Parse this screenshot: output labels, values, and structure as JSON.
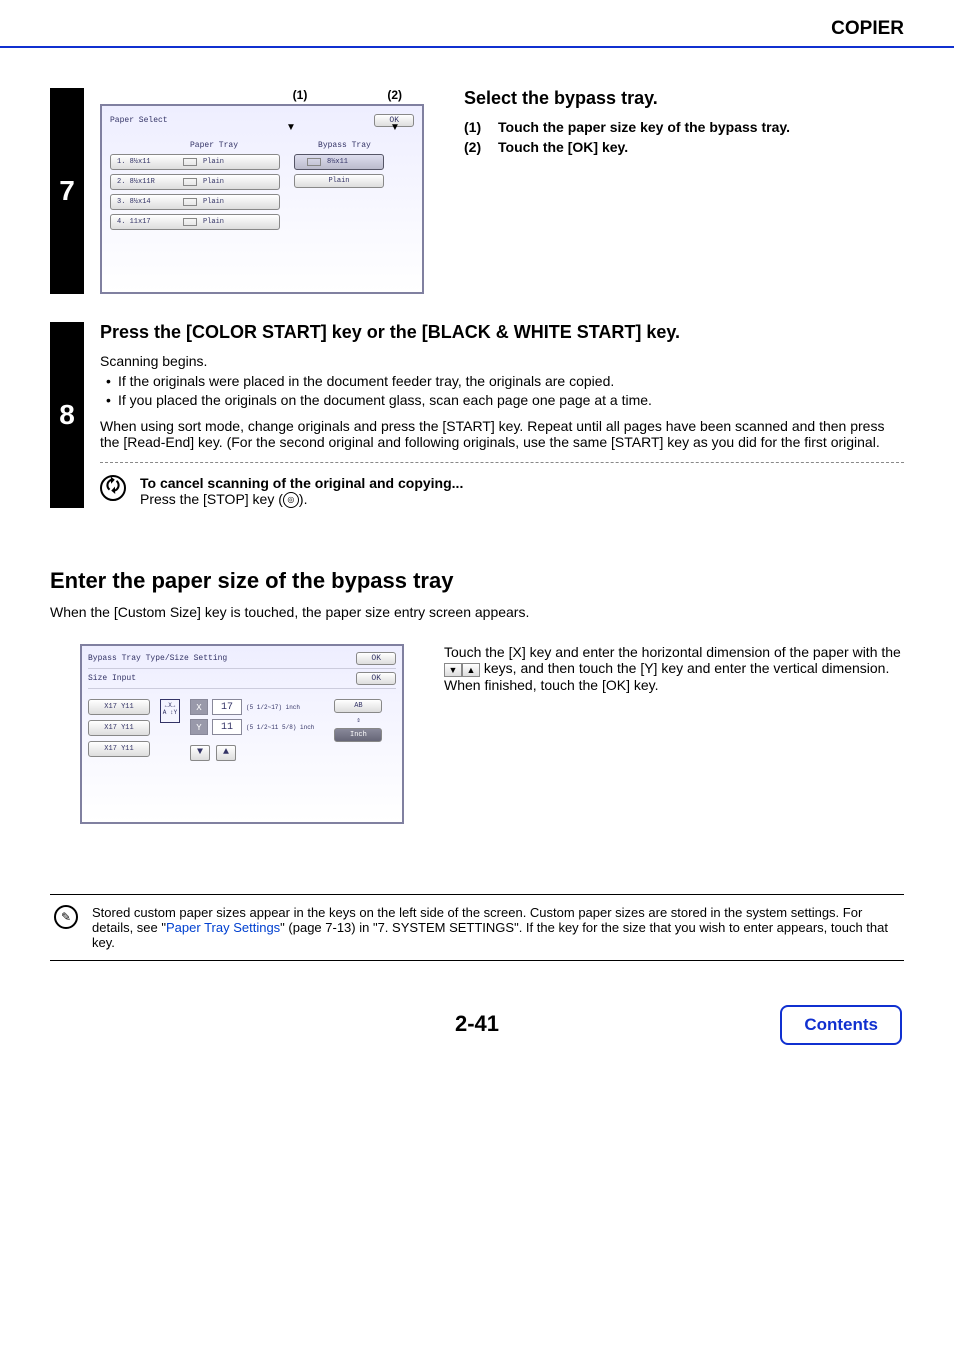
{
  "header": {
    "section": "COPIER"
  },
  "step7": {
    "number": "7",
    "callouts": [
      "(1)",
      "(2)"
    ],
    "screen": {
      "title": "Paper Select",
      "ok": "OK",
      "paper_tray_label": "Paper Tray",
      "bypass_tray_label": "Bypass Tray",
      "trays": [
        {
          "label": "1. 8½x11",
          "type": "Plain"
        },
        {
          "label": "2. 8½x11R",
          "type": "Plain"
        },
        {
          "label": "3. 8½x14",
          "type": "Plain"
        },
        {
          "label": "4. 11x17",
          "type": "Plain"
        }
      ],
      "bypass": {
        "size": "8½x11",
        "type": "Plain"
      }
    },
    "heading": "Select the bypass tray.",
    "items": [
      {
        "no": "(1)",
        "text": "Touch the paper size key of the bypass tray."
      },
      {
        "no": "(2)",
        "text": "Touch the [OK] key."
      }
    ]
  },
  "step8": {
    "number": "8",
    "heading": "Press the [COLOR START] key or the [BLACK & WHITE START] key.",
    "line1": "Scanning begins.",
    "bullets": [
      "If the originals were placed in the document feeder tray, the originals are copied.",
      "If you placed the originals on the document glass, scan each page one page at a time."
    ],
    "indent": "When using sort mode, change originals and press the [START] key. Repeat until all pages have been scanned and then press the [Read-End] key. (For the second original and following originals, use the same [START] key as you did for the first original.",
    "cancel_title": "To cancel scanning of the original and copying...",
    "cancel_text_a": "Press the [STOP] key (",
    "cancel_text_b": ")."
  },
  "section2": {
    "heading": "Enter the paper size of the bypass tray",
    "intro": "When the [Custom Size] key is touched, the paper size entry screen appears.",
    "screen": {
      "title": "Bypass Tray Type/Size Setting",
      "subtitle": "Size Input",
      "ok": "OK",
      "presets": [
        "X17  Y11",
        "X17  Y11",
        "X17  Y11"
      ],
      "xlabel": "X",
      "xval": "17",
      "xrange": "(5 1/2~17)\ninch",
      "ylabel": "Y",
      "yval": "11",
      "yrange": "(5 1/2~11 5/8)\ninch",
      "ab": "AB",
      "inch": "Inch"
    },
    "text_a": "Touch the [X] key and enter the horizontal dimension of the paper with the ",
    "text_b": " keys, and then touch the [Y] key and enter the vertical dimension. When finished, touch the [OK] key."
  },
  "note": {
    "text_a": "Stored custom paper sizes appear in the keys on the left side of the screen. Custom paper sizes are stored in the system settings. For details, see \"",
    "link": "Paper Tray Settings",
    "text_b": "\" (page 7-13) in \"7. SYSTEM SETTINGS\". If the key for the size that you wish to enter appears, touch that key."
  },
  "footer": {
    "page": "2-41",
    "contents": "Contents"
  }
}
